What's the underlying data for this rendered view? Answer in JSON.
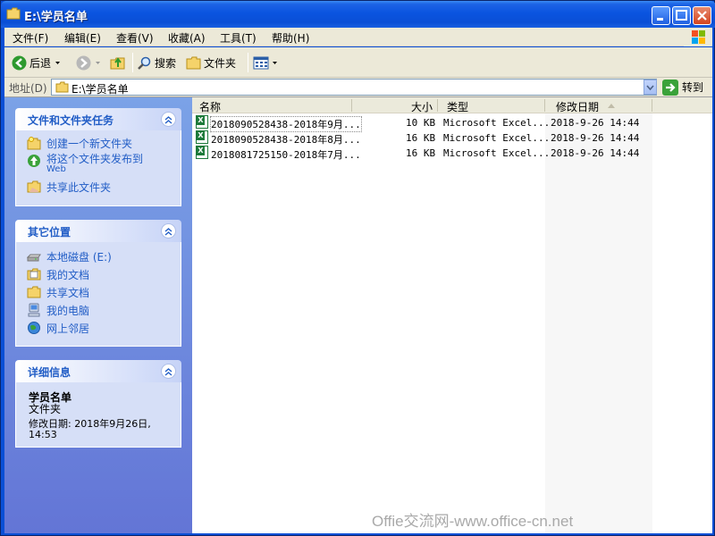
{
  "window": {
    "title": "E:\\学员名单",
    "buttons": [
      "minimize",
      "maximize",
      "close"
    ]
  },
  "menu": [
    "文件(F)",
    "编辑(E)",
    "查看(V)",
    "收藏(A)",
    "工具(T)",
    "帮助(H)"
  ],
  "toolbar": {
    "back_label": "后退",
    "search_label": "搜索",
    "folders_label": "文件夹"
  },
  "address": {
    "label": "地址(D)",
    "value": "E:\\学员名单",
    "go_label": "转到"
  },
  "left": {
    "tasks": {
      "title": "文件和文件夹任务",
      "items": [
        {
          "label": "创建一个新文件夹",
          "icon": "new-folder-icon"
        },
        {
          "label": "将这个文件夹发布到",
          "sublabel": "Web",
          "icon": "publish-web-icon"
        },
        {
          "label": "共享此文件夹",
          "icon": "share-folder-icon"
        }
      ]
    },
    "places": {
      "title": "其它位置",
      "items": [
        {
          "label": "本地磁盘 (E:)",
          "icon": "drive-icon"
        },
        {
          "label": "我的文档",
          "icon": "documents-icon"
        },
        {
          "label": "共享文档",
          "icon": "shared-docs-icon"
        },
        {
          "label": "我的电脑",
          "icon": "computer-icon"
        },
        {
          "label": "网上邻居",
          "icon": "network-icon"
        }
      ]
    },
    "details": {
      "title": "详细信息",
      "name": "学员名单",
      "kind": "文件夹",
      "modified_line1": "修改日期: 2018年9月26日,",
      "modified_line2": "14:53"
    }
  },
  "files": {
    "columns": [
      "名称",
      "大小",
      "类型",
      "修改日期"
    ],
    "rows": [
      {
        "name": "2018090528438-2018年9月...",
        "size": "10 KB",
        "type": "Microsoft Excel...",
        "modified": "2018-9-26 14:44"
      },
      {
        "name": "2018090528438-2018年8月...",
        "size": "16 KB",
        "type": "Microsoft Excel...",
        "modified": "2018-9-26 14:44"
      },
      {
        "name": "2018081725150-2018年7月...",
        "size": "16 KB",
        "type": "Microsoft Excel...",
        "modified": "2018-9-26 14:44"
      }
    ]
  },
  "watermark": "Offie交流网-www.office-cn.net"
}
